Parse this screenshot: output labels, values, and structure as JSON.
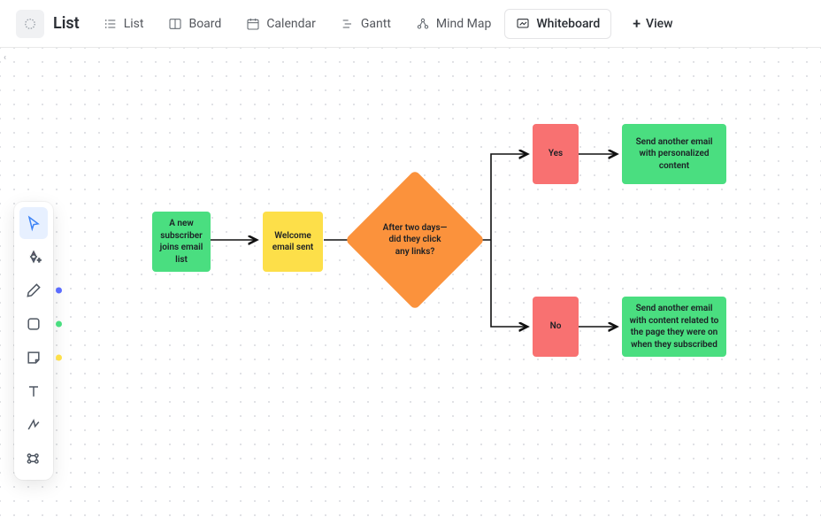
{
  "title": "List",
  "tabs": {
    "list": "List",
    "board": "Board",
    "calendar": "Calendar",
    "gantt": "Gantt",
    "mindmap": "Mind Map",
    "whiteboard": "Whiteboard"
  },
  "add_view": "View",
  "nodes": {
    "start": "A new subscriber joins email list",
    "welcome": "Welcome email sent",
    "decision": "After two days—did they click any links?",
    "yes": "Yes",
    "no": "No",
    "yes_action": "Send another email with personalized content",
    "no_action": "Send another email with content related to the page they were on when they subscribed"
  },
  "tools": {
    "cursor": "cursor",
    "ai": "ai",
    "pen": "pen",
    "shape": "shape",
    "sticky": "sticky",
    "text": "text",
    "connector": "connector",
    "more": "more"
  },
  "tool_dots": {
    "pen": "#5b6cff",
    "shape": "#4ade80",
    "sticky": "#fddf49"
  }
}
